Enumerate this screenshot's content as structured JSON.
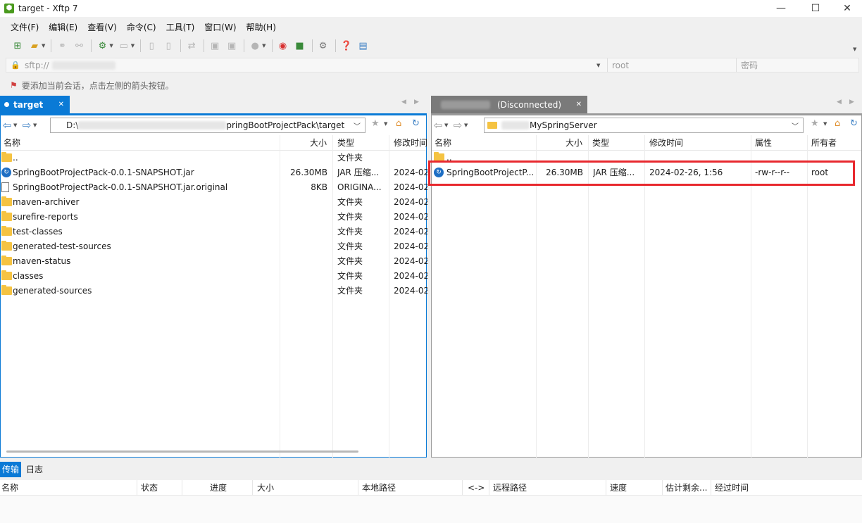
{
  "window": {
    "title": "target - Xftp 7",
    "icon": "xftp-icon"
  },
  "menu": [
    "文件(F)",
    "编辑(E)",
    "查看(V)",
    "命令(C)",
    "工具(T)",
    "窗口(W)",
    "帮助(H)"
  ],
  "address": {
    "text": "sftp://",
    "user_placeholder": "root",
    "password_placeholder": "密码"
  },
  "hint": "要添加当前会话，点击左侧的箭头按钮。",
  "local": {
    "tab_label": "target",
    "path_prefix": "D:\\",
    "path_suffix": "pringBootProjectPack\\target",
    "columns": {
      "name": "名称",
      "size": "大小",
      "type": "类型",
      "modified": "修改时间"
    },
    "rows": [
      {
        "icon": "folder",
        "name": "..",
        "size": "",
        "type": "文件夹",
        "modified": ""
      },
      {
        "icon": "jar",
        "name": "SpringBootProjectPack-0.0.1-SNAPSHOT.jar",
        "size": "26.30MB",
        "type": "JAR 压缩...",
        "modified": "2024-02"
      },
      {
        "icon": "doc",
        "name": "SpringBootProjectPack-0.0.1-SNAPSHOT.jar.original",
        "size": "8KB",
        "type": "ORIGINA...",
        "modified": "2024-02"
      },
      {
        "icon": "folder",
        "name": "maven-archiver",
        "size": "",
        "type": "文件夹",
        "modified": "2024-02"
      },
      {
        "icon": "folder",
        "name": "surefire-reports",
        "size": "",
        "type": "文件夹",
        "modified": "2024-02"
      },
      {
        "icon": "folder",
        "name": "test-classes",
        "size": "",
        "type": "文件夹",
        "modified": "2024-02"
      },
      {
        "icon": "folder",
        "name": "generated-test-sources",
        "size": "",
        "type": "文件夹",
        "modified": "2024-02"
      },
      {
        "icon": "folder",
        "name": "maven-status",
        "size": "",
        "type": "文件夹",
        "modified": "2024-02"
      },
      {
        "icon": "folder",
        "name": "classes",
        "size": "",
        "type": "文件夹",
        "modified": "2024-02"
      },
      {
        "icon": "folder",
        "name": "generated-sources",
        "size": "",
        "type": "文件夹",
        "modified": "2024-02"
      }
    ]
  },
  "remote": {
    "tab_label": "(Disconnected)",
    "path_suffix": "MySpringServer",
    "columns": {
      "name": "名称",
      "size": "大小",
      "type": "类型",
      "modified": "修改时间",
      "attr": "属性",
      "owner": "所有者"
    },
    "rows": [
      {
        "icon": "folder",
        "name": "..",
        "size": "",
        "type": "",
        "modified": "",
        "attr": "",
        "owner": ""
      },
      {
        "icon": "jar",
        "name": "SpringBootProjectP...",
        "size": "26.30MB",
        "type": "JAR 压缩...",
        "modified": "2024-02-26, 1:56",
        "attr": "-rw-r--r--",
        "owner": "root"
      }
    ]
  },
  "transfer": {
    "tabs": [
      "传输",
      "日志"
    ],
    "columns": [
      "名称",
      "状态",
      "进度",
      "大小",
      "本地路径",
      "<->",
      "远程路径",
      "速度",
      "估计剩余...",
      "经过时间"
    ]
  },
  "colors": {
    "accent": "#0a7ad6",
    "highlight": "#e8282e",
    "folder": "#f5c342"
  }
}
